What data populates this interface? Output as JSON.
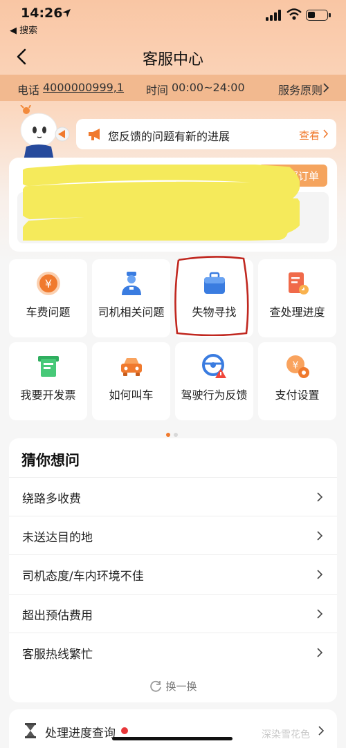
{
  "status_bar": {
    "time": "14:26",
    "back_app": "◀ 搜索"
  },
  "nav": {
    "title": "客服中心"
  },
  "info_bar": {
    "phone_label": "电话",
    "phone_number": "4000000999,1",
    "hours_label": "时间",
    "hours_value": "00:00~24:00",
    "principles_label": "服务原则"
  },
  "notice": {
    "text": "您反馈的问题有新的进展",
    "view_label": "查看"
  },
  "order_card": {
    "all_orders_label": "部订单"
  },
  "grid": {
    "tiles": [
      {
        "label": "车费问题",
        "icon": "yuan-coin-icon"
      },
      {
        "label": "司机相关问题",
        "icon": "driver-icon"
      },
      {
        "label": "失物寻找",
        "icon": "briefcase-icon"
      },
      {
        "label": "查处理进度",
        "icon": "document-progress-icon"
      },
      {
        "label": "我要开发票",
        "icon": "invoice-icon"
      },
      {
        "label": "如何叫车",
        "icon": "car-icon"
      },
      {
        "label": "驾驶行为反馈",
        "icon": "steering-wheel-warning-icon"
      },
      {
        "label": "支付设置",
        "icon": "payment-settings-icon"
      }
    ]
  },
  "guess": {
    "title": "猜你想问",
    "questions": [
      "绕路多收费",
      "未送达目的地",
      "司机态度/车内环境不佳",
      "超出预估费用",
      "客服热线繁忙"
    ],
    "refresh_label": "换一换"
  },
  "progress": {
    "label": "处理进度查询"
  },
  "watermark": "深染雪花色",
  "colors": {
    "accent": "#f07a2e",
    "header_bg": "#f9c6a4",
    "info_bar_bg": "#f2b98f",
    "annotation_red": "#c0271f"
  }
}
